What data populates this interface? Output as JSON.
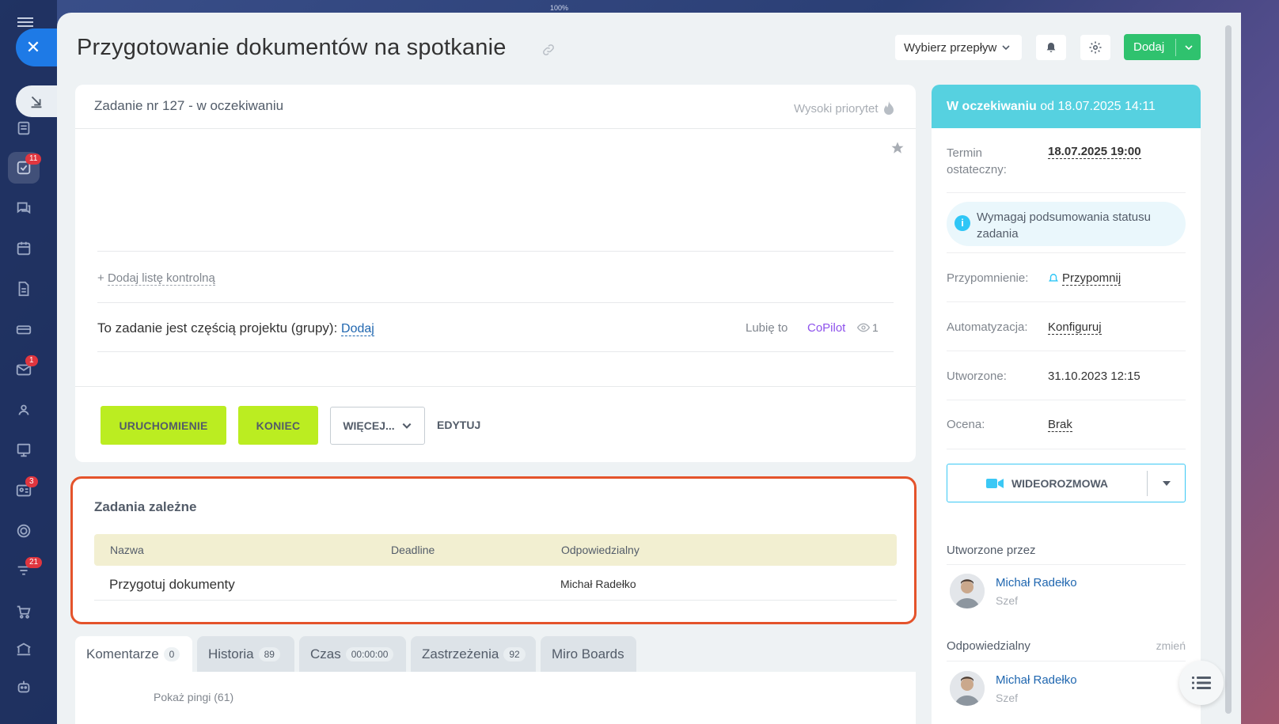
{
  "window": {
    "zoom": "100%"
  },
  "sidebar": {
    "badges": {
      "tasks": "11",
      "mail": "1",
      "contacts": "3",
      "sites": "21"
    }
  },
  "header": {
    "title": "Przygotowanie dokumentów na spotkanie",
    "flow_label": "Wybierz przepływ",
    "add_label": "Dodaj"
  },
  "task": {
    "heading": "Zadanie nr 127 - w oczekiwaniu",
    "priority": "Wysoki priorytet",
    "checklist_prefix": "+",
    "checklist_link": "Dodaj listę kontrolną",
    "project_text": "To zadanie jest częścią projektu (grupy):",
    "project_link": "Dodaj",
    "like": "Lubię to",
    "copilot": "CoPilot",
    "views": "1",
    "buttons": {
      "start": "URUCHOMIENIE",
      "finish": "KONIEC",
      "more": "WIĘCEJ...",
      "edit": "EDYTUJ"
    }
  },
  "dependent": {
    "title": "Zadania zależne",
    "columns": [
      "Nazwa",
      "Deadline",
      "Odpowiedzialny"
    ],
    "rows": [
      {
        "name": "Przygotuj dokumenty",
        "deadline": "",
        "responsible": "Michał Radełko"
      }
    ]
  },
  "tabs": [
    {
      "label": "Komentarze",
      "count": "0"
    },
    {
      "label": "Historia",
      "count": "89"
    },
    {
      "label": "Czas",
      "count": "00:00:00"
    },
    {
      "label": "Zastrzeżenia",
      "count": "92"
    },
    {
      "label": "Miro Boards",
      "count": ""
    }
  ],
  "comments": {
    "pings": "Pokaż pingi (61)"
  },
  "right_panel": {
    "status": "W oczekiwaniu",
    "status_since": "od 18.07.2025 14:11",
    "deadline_label": "Termin ostateczny:",
    "deadline_value": "18.07.2025 19:00",
    "require_summary": "Wymagaj podsumowania statusu zadania",
    "reminder_label": "Przypomnienie:",
    "reminder_value": "Przypomnij",
    "automation_label": "Automatyzacja:",
    "automation_value": "Konfiguruj",
    "created_label": "Utworzone:",
    "created_value": "31.10.2023 12:15",
    "rating_label": "Ocena:",
    "rating_value": "Brak",
    "video_label": "WIDEOROZMOWA",
    "created_by_label": "Utworzone przez",
    "creator_name": "Michał Radełko",
    "creator_role": "Szef",
    "responsible_label": "Odpowiedzialny",
    "change_label": "zmień",
    "responsible_name": "Michał Radełko",
    "responsible_role": "Szef"
  },
  "colors": {
    "accent": "#2fc26e",
    "lime": "#bbed21",
    "status": "#56d1e0",
    "highlight": "#e4532b"
  }
}
